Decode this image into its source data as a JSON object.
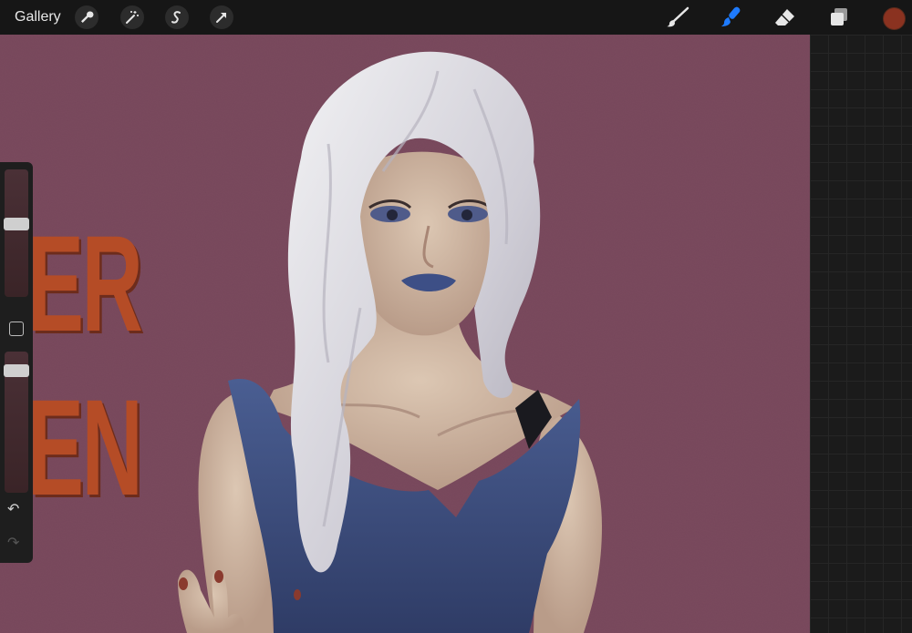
{
  "toolbar": {
    "gallery_label": "Gallery",
    "left_tools": [
      "wrench-icon",
      "magic-wand-icon",
      "selection-icon",
      "transform-arrow-icon"
    ],
    "right_tools": [
      "brush-icon",
      "smudge-icon",
      "eraser-icon",
      "layers-icon"
    ],
    "active_tool": "smudge-icon",
    "accent_color": "#1e7bff",
    "current_color": "#8a3220"
  },
  "sidebar": {
    "brush_size_level": 0.58,
    "opacity_level": 0.9
  },
  "canvas": {
    "background_color": "#7b4a5e",
    "poster_line_1": "ER",
    "poster_line_2": "EN",
    "poster_color": "#b54c26"
  }
}
